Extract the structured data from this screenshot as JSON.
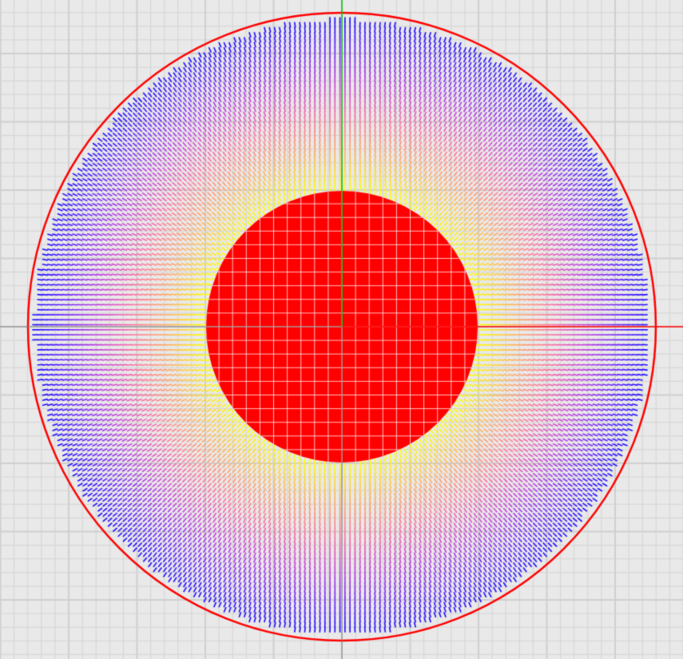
{
  "viewport": {
    "background": "#e9e9e9",
    "grid_minor_color": "#d4d4d4",
    "grid_major_color": "#cfcfcf",
    "x_axis_color": "#ff0000",
    "y_axis_color": "#00c000",
    "negative_axis_color": "#808080"
  },
  "scene": {
    "inner_disk_color": "#ff0000",
    "outer_circle_color": "#ff0000",
    "field_gradient": [
      "#ffff00",
      "#ffb060",
      "#ff70a0",
      "#c040e0",
      "#6020ff",
      "#0000ff"
    ]
  }
}
